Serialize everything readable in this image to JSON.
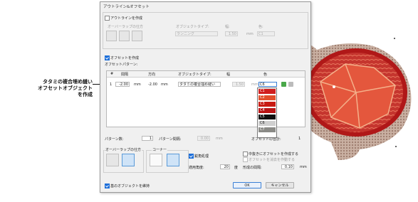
{
  "callout": {
    "line1": "タタミの複合埋め縫い",
    "line2": "オフセットオブジェクト",
    "line3": "を作成"
  },
  "dialog": {
    "title": "アウトライン&オフセット",
    "outline": {
      "checkbox": "アウトラインを作成",
      "overlap_label": "オーバーラップの仕方",
      "object_type_label": "オブジェクトタイプ:",
      "width_label": "幅:",
      "color_label": "色:",
      "object_type_value": "ランニング",
      "width_value": "1.50",
      "width_unit": "mm",
      "color_value": "C1"
    },
    "offset": {
      "checkbox": "オフセットを作成",
      "pattern_label": "オフセットパターン:"
    },
    "table": {
      "headers": [
        "#",
        "間隔",
        "",
        "方向",
        "オブジェクトタイプ:",
        "幅",
        "",
        "色"
      ],
      "row": {
        "num": "1",
        "gap": "-2.00",
        "gap_unit": "mm",
        "dir": "-2.00",
        "dir_unit": "mm",
        "type": "タタミの複合埋め縫い",
        "width": "1.50",
        "width_unit": "mm",
        "color": "C6"
      }
    },
    "colors": [
      {
        "label": "C1",
        "hex": "#d01e1e"
      },
      {
        "label": "C2",
        "hex": "#e24f2c"
      },
      {
        "label": "C3",
        "hex": "#c81a12"
      },
      {
        "label": "C4",
        "hex": "#b81414"
      },
      {
        "label": "C5",
        "hex": "#111111"
      },
      {
        "label": "C6",
        "hex": "#cfcfcf"
      },
      {
        "label": "C7",
        "hex": "#8a8a86"
      }
    ],
    "pattern_count_label": "パターン数:",
    "pattern_count_value": "1",
    "pattern_gap_label": "パターン間隔:",
    "pattern_gap_value": "0.00",
    "pattern_gap_unit": "mm",
    "offset_total_label": "オフセットの合計:",
    "offset_total_value": "1",
    "overlap_group_label": "オーバーラップの仕方",
    "corner_group_label": "コーナー",
    "shortstitch": {
      "label": "鋭角処理",
      "checked": true
    },
    "angle_label": "適用角度:",
    "angle_value": "20",
    "angle_unit": "度",
    "middle_checkbox": "中抜きにオフセットを作成する",
    "remove_checkbox": "オフセットを消去を作動する",
    "shape_label": "形成の間隔:",
    "shape_value": "0.10",
    "shape_unit": "mm",
    "keep_checkbox": "基のオブジェクトを維持",
    "ok": "OK",
    "cancel": "キャンセル"
  }
}
